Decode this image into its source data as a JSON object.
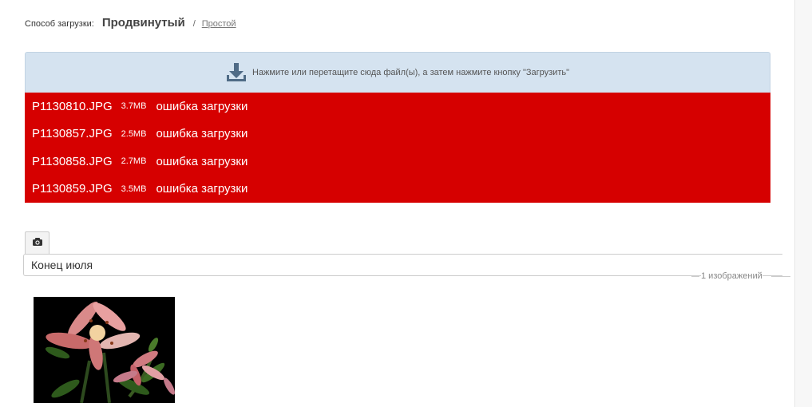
{
  "upload_mode": {
    "label": "Способ загрузки:",
    "active": "Продвинутый",
    "separator": "/",
    "alternative": "Простой"
  },
  "dropzone": {
    "icon": "download-icon",
    "text": "Нажмите или перетащите сюда файл(ы), а затем нажмите кнопку \"Загрузить\""
  },
  "files": [
    {
      "name": "P1130810.JPG",
      "size": "3.7MB",
      "status": "ошибка загрузки"
    },
    {
      "name": "P1130857.JPG",
      "size": "2.5MB",
      "status": "ошибка загрузки"
    },
    {
      "name": "P1130858.JPG",
      "size": "2.7MB",
      "status": "ошибка загрузки"
    },
    {
      "name": "P1130859.JPG",
      "size": "3.5MB",
      "status": "ошибка загрузки"
    }
  ],
  "album": {
    "tab_icon": "camera-icon",
    "title_value": "Конец июля",
    "count": "1 изображений"
  },
  "colors": {
    "error_bg": "#d60000",
    "dropzone_bg": "#d5e3f0",
    "icon": "#4f6b86"
  }
}
